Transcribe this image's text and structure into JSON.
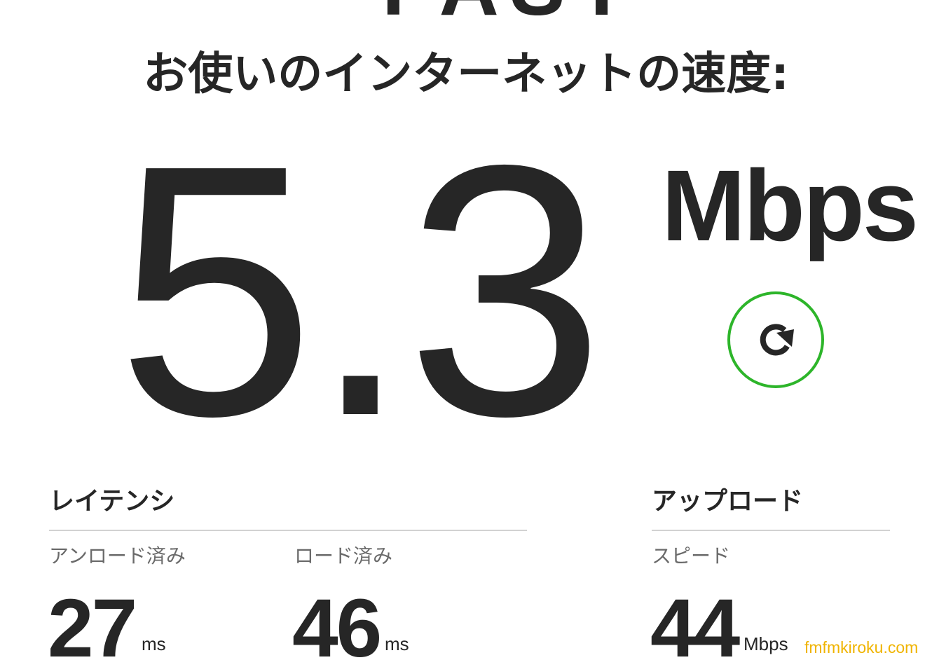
{
  "header": {
    "brand": "FAST",
    "headline": "お使いのインターネットの速度:"
  },
  "speed": {
    "value": "5.3",
    "units": "Mbps",
    "refresh_icon": "refresh-icon"
  },
  "latency": {
    "title": "レイテンシ",
    "unloaded": {
      "label": "アンロード済み",
      "value": "27",
      "unit": "ms"
    },
    "loaded": {
      "label": "ロード済み",
      "value": "46",
      "unit": "ms"
    }
  },
  "upload": {
    "title": "アップロード",
    "speed": {
      "label": "スピード",
      "value": "44",
      "unit": "Mbps"
    }
  },
  "watermark": "fmfmkiroku.com",
  "colors": {
    "text": "#262626",
    "accent_green": "#2db52a",
    "muted": "#6a6a6a",
    "divider": "#d2d2d2",
    "watermark": "#f0b400"
  }
}
